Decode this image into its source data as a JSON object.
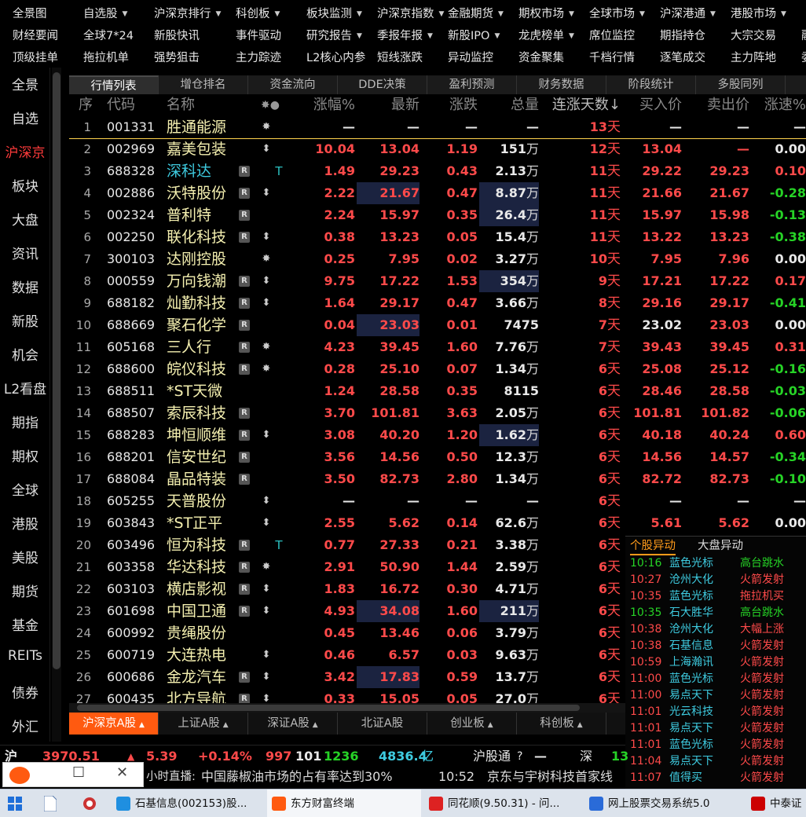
{
  "top_menu": {
    "rows": [
      [
        {
          "label": "全景图",
          "arrow": false
        },
        {
          "label": "自选股",
          "arrow": true
        },
        {
          "label": "沪深京排行",
          "arrow": true
        },
        {
          "label": "科创板",
          "arrow": true
        },
        {
          "label": "板块监测",
          "arrow": true
        },
        {
          "label": "沪深京指数",
          "arrow": true
        },
        {
          "label": "金融期货",
          "arrow": true
        },
        {
          "label": "期权市场",
          "arrow": true
        },
        {
          "label": "全球市场",
          "arrow": true
        },
        {
          "label": "沪深港通",
          "arrow": true
        },
        {
          "label": "港股市场",
          "arrow": true
        }
      ],
      [
        {
          "label": "财经要闻",
          "arrow": false
        },
        {
          "label": "全球7*24",
          "arrow": false
        },
        {
          "label": "新股快讯",
          "arrow": false
        },
        {
          "label": "事件驱动",
          "arrow": false
        },
        {
          "label": "研究报告",
          "arrow": true
        },
        {
          "label": "季报年报",
          "arrow": true
        },
        {
          "label": "新股IPO",
          "arrow": true
        },
        {
          "label": "龙虎榜单",
          "arrow": true
        },
        {
          "label": "席位监控",
          "arrow": false
        },
        {
          "label": "期指持仓",
          "arrow": false
        },
        {
          "label": "大宗交易",
          "arrow": false
        },
        {
          "label": "融",
          "arrow": false
        }
      ],
      [
        {
          "label": "顶级挂单",
          "arrow": false
        },
        {
          "label": "拖拉机单",
          "arrow": false
        },
        {
          "label": "强势狙击",
          "arrow": false
        },
        {
          "label": "主力踪迹",
          "arrow": false
        },
        {
          "label": "L2核心内参",
          "arrow": false
        },
        {
          "label": "短线涨跌",
          "arrow": false
        },
        {
          "label": "异动监控",
          "arrow": false
        },
        {
          "label": "资金聚集",
          "arrow": false
        },
        {
          "label": "千档行情",
          "arrow": false
        },
        {
          "label": "逐笔成交",
          "arrow": false
        },
        {
          "label": "主力阵地",
          "arrow": false
        },
        {
          "label": "委",
          "arrow": false
        }
      ]
    ]
  },
  "left_nav": [
    "全景",
    "自选",
    "沪深京",
    "板块",
    "大盘",
    "资讯",
    "数据",
    "新股",
    "机会",
    "L2看盘",
    "期指",
    "期权",
    "全球",
    "港股",
    "美股",
    "期货",
    "基金",
    "REITs",
    "债券",
    "外汇"
  ],
  "left_nav_active": "沪深京",
  "tabs": [
    "行情列表",
    "增仓排名",
    "资金流向",
    "DDE决策",
    "盈利预测",
    "财务数据",
    "阶段统计",
    "多股同列"
  ],
  "active_tab": "行情列表",
  "columns": {
    "seq": "序",
    "code": "代码",
    "name": "名称",
    "flags": "✸●",
    "chg_pct": "涨幅%",
    "last": "最新",
    "chg": "涨跌",
    "volume": "总量",
    "streak": "连涨天数↓",
    "bid": "买入价",
    "ask": "卖出价",
    "speed": "涨速%"
  },
  "rows": [
    {
      "seq": "1",
      "code": "001331",
      "name": "胜通能源",
      "r": false,
      "mark": "✸",
      "chg_pct": "—",
      "last": "—",
      "chg": "—",
      "vol_num": "—",
      "vol_unit": "",
      "days": "13",
      "bid": "—",
      "ask": "—",
      "speed": "—",
      "color": "white",
      "speed_color": "white",
      "name_color": "yellow",
      "hl_last": false,
      "hl_vol": false
    },
    {
      "seq": "2",
      "code": "002969",
      "name": "嘉美包装",
      "r": false,
      "mark": "⬍",
      "chg_pct": "10.04",
      "last": "13.04",
      "chg": "1.19",
      "vol_num": "151",
      "vol_unit": "万",
      "days": "12",
      "bid": "13.04",
      "ask": "—",
      "speed": "0.00",
      "color": "red",
      "speed_color": "white",
      "name_color": "yellow",
      "hl_last": false,
      "hl_vol": false
    },
    {
      "seq": "3",
      "code": "688328",
      "name": "深科达",
      "r": true,
      "mark": "T",
      "chg_pct": "1.49",
      "last": "29.23",
      "chg": "0.43",
      "vol_num": "2.13",
      "vol_unit": "万",
      "days": "11",
      "bid": "29.22",
      "ask": "29.23",
      "speed": "0.10",
      "color": "red",
      "speed_color": "red",
      "name_color": "cyan",
      "hl_last": false,
      "hl_vol": false
    },
    {
      "seq": "4",
      "code": "002886",
      "name": "沃特股份",
      "r": true,
      "mark": "⬍",
      "chg_pct": "2.22",
      "last": "21.67",
      "chg": "0.47",
      "vol_num": "8.87",
      "vol_unit": "万",
      "days": "11",
      "bid": "21.66",
      "ask": "21.67",
      "speed": "-0.28",
      "color": "red",
      "speed_color": "green",
      "name_color": "yellow",
      "hl_last": true,
      "hl_vol": true
    },
    {
      "seq": "5",
      "code": "002324",
      "name": "普利特",
      "r": true,
      "mark": "",
      "chg_pct": "2.24",
      "last": "15.97",
      "chg": "0.35",
      "vol_num": "26.4",
      "vol_unit": "万",
      "days": "11",
      "bid": "15.97",
      "ask": "15.98",
      "speed": "-0.13",
      "color": "red",
      "speed_color": "green",
      "name_color": "yellow",
      "hl_last": false,
      "hl_vol": true
    },
    {
      "seq": "6",
      "code": "002250",
      "name": "联化科技",
      "r": true,
      "mark": "⬍",
      "chg_pct": "0.38",
      "last": "13.23",
      "chg": "0.05",
      "vol_num": "15.4",
      "vol_unit": "万",
      "days": "11",
      "bid": "13.22",
      "ask": "13.23",
      "speed": "-0.38",
      "color": "red",
      "speed_color": "green",
      "name_color": "yellow",
      "hl_last": false,
      "hl_vol": false
    },
    {
      "seq": "7",
      "code": "300103",
      "name": "达刚控股",
      "r": false,
      "mark": "✸",
      "chg_pct": "0.25",
      "last": "7.95",
      "chg": "0.02",
      "vol_num": "3.27",
      "vol_unit": "万",
      "days": "10",
      "bid": "7.95",
      "ask": "7.96",
      "speed": "0.00",
      "color": "red",
      "speed_color": "white",
      "name_color": "yellow",
      "hl_last": false,
      "hl_vol": false
    },
    {
      "seq": "8",
      "code": "000559",
      "name": "万向钱潮",
      "r": true,
      "mark": "⬍",
      "chg_pct": "9.75",
      "last": "17.22",
      "chg": "1.53",
      "vol_num": "354",
      "vol_unit": "万",
      "days": "9",
      "bid": "17.21",
      "ask": "17.22",
      "speed": "0.17",
      "color": "red",
      "speed_color": "red",
      "name_color": "yellow",
      "hl_last": false,
      "hl_vol": true
    },
    {
      "seq": "9",
      "code": "688182",
      "name": "灿勤科技",
      "r": true,
      "mark": "⬍",
      "chg_pct": "1.64",
      "last": "29.17",
      "chg": "0.47",
      "vol_num": "3.66",
      "vol_unit": "万",
      "days": "8",
      "bid": "29.16",
      "ask": "29.17",
      "speed": "-0.41",
      "color": "red",
      "speed_color": "green",
      "name_color": "yellow",
      "hl_last": false,
      "hl_vol": false
    },
    {
      "seq": "10",
      "code": "688669",
      "name": "聚石化学",
      "r": true,
      "mark": "",
      "chg_pct": "0.04",
      "last": "23.03",
      "chg": "0.01",
      "vol_num": "7475",
      "vol_unit": "",
      "days": "7",
      "bid": "23.02",
      "ask": "23.03",
      "speed": "0.00",
      "color": "red",
      "speed_color": "white",
      "name_color": "yellow",
      "hl_last": true,
      "hl_vol": false,
      "bid_color": "white"
    },
    {
      "seq": "11",
      "code": "605168",
      "name": "三人行",
      "r": true,
      "mark": "✸",
      "chg_pct": "4.23",
      "last": "39.45",
      "chg": "1.60",
      "vol_num": "7.76",
      "vol_unit": "万",
      "days": "7",
      "bid": "39.43",
      "ask": "39.45",
      "speed": "0.31",
      "color": "red",
      "speed_color": "red",
      "name_color": "yellow",
      "hl_last": false,
      "hl_vol": false
    },
    {
      "seq": "12",
      "code": "688600",
      "name": "皖仪科技",
      "r": true,
      "mark": "✸",
      "chg_pct": "0.28",
      "last": "25.10",
      "chg": "0.07",
      "vol_num": "1.34",
      "vol_unit": "万",
      "days": "6",
      "bid": "25.08",
      "ask": "25.12",
      "speed": "-0.16",
      "color": "red",
      "speed_color": "green",
      "name_color": "yellow",
      "hl_last": false,
      "hl_vol": false
    },
    {
      "seq": "13",
      "code": "688511",
      "name": "*ST天微",
      "r": false,
      "mark": "",
      "chg_pct": "1.24",
      "last": "28.58",
      "chg": "0.35",
      "vol_num": "8115",
      "vol_unit": "",
      "days": "6",
      "bid": "28.46",
      "ask": "28.58",
      "speed": "-0.03",
      "color": "red",
      "speed_color": "green",
      "name_color": "yellow",
      "hl_last": false,
      "hl_vol": false
    },
    {
      "seq": "14",
      "code": "688507",
      "name": "索辰科技",
      "r": true,
      "mark": "",
      "chg_pct": "3.70",
      "last": "101.81",
      "chg": "3.63",
      "vol_num": "2.05",
      "vol_unit": "万",
      "days": "6",
      "bid": "101.81",
      "ask": "101.82",
      "speed": "-0.06",
      "color": "red",
      "speed_color": "green",
      "name_color": "yellow",
      "hl_last": false,
      "hl_vol": false
    },
    {
      "seq": "15",
      "code": "688283",
      "name": "坤恒顺维",
      "r": true,
      "mark": "⬍",
      "chg_pct": "3.08",
      "last": "40.20",
      "chg": "1.20",
      "vol_num": "1.62",
      "vol_unit": "万",
      "days": "6",
      "bid": "40.18",
      "ask": "40.24",
      "speed": "0.60",
      "color": "red",
      "speed_color": "red",
      "name_color": "yellow",
      "hl_last": false,
      "hl_vol": true
    },
    {
      "seq": "16",
      "code": "688201",
      "name": "信安世纪",
      "r": true,
      "mark": "",
      "chg_pct": "3.56",
      "last": "14.56",
      "chg": "0.50",
      "vol_num": "12.3",
      "vol_unit": "万",
      "days": "6",
      "bid": "14.56",
      "ask": "14.57",
      "speed": "-0.34",
      "color": "red",
      "speed_color": "green",
      "name_color": "yellow",
      "hl_last": false,
      "hl_vol": false
    },
    {
      "seq": "17",
      "code": "688084",
      "name": "晶品特装",
      "r": true,
      "mark": "",
      "chg_pct": "3.50",
      "last": "82.73",
      "chg": "2.80",
      "vol_num": "1.34",
      "vol_unit": "万",
      "days": "6",
      "bid": "82.72",
      "ask": "82.73",
      "speed": "-0.10",
      "color": "red",
      "speed_color": "green",
      "name_color": "yellow",
      "hl_last": false,
      "hl_vol": false
    },
    {
      "seq": "18",
      "code": "605255",
      "name": "天普股份",
      "r": false,
      "mark": "⬍",
      "chg_pct": "—",
      "last": "—",
      "chg": "—",
      "vol_num": "—",
      "vol_unit": "",
      "days": "6",
      "bid": "—",
      "ask": "—",
      "speed": "—",
      "color": "white",
      "speed_color": "white",
      "name_color": "yellow",
      "hl_last": false,
      "hl_vol": false
    },
    {
      "seq": "19",
      "code": "603843",
      "name": "*ST正平",
      "r": false,
      "mark": "⬍",
      "chg_pct": "2.55",
      "last": "5.62",
      "chg": "0.14",
      "vol_num": "62.6",
      "vol_unit": "万",
      "days": "6",
      "bid": "5.61",
      "ask": "5.62",
      "speed": "0.00",
      "color": "red",
      "speed_color": "white",
      "name_color": "yellow",
      "hl_last": false,
      "hl_vol": false
    },
    {
      "seq": "20",
      "code": "603496",
      "name": "恒为科技",
      "r": true,
      "mark": "T",
      "chg_pct": "0.77",
      "last": "27.33",
      "chg": "0.21",
      "vol_num": "3.38",
      "vol_unit": "万",
      "days": "6",
      "bid": "",
      "ask": "",
      "speed": "",
      "color": "red",
      "speed_color": "white",
      "name_color": "yellow",
      "hl_last": false,
      "hl_vol": false
    },
    {
      "seq": "21",
      "code": "603358",
      "name": "华达科技",
      "r": true,
      "mark": "✸",
      "chg_pct": "2.91",
      "last": "50.90",
      "chg": "1.44",
      "vol_num": "2.59",
      "vol_unit": "万",
      "days": "6",
      "bid": "",
      "ask": "",
      "speed": "",
      "color": "red",
      "speed_color": "white",
      "name_color": "yellow",
      "hl_last": false,
      "hl_vol": false
    },
    {
      "seq": "22",
      "code": "603103",
      "name": "横店影视",
      "r": true,
      "mark": "⬍",
      "chg_pct": "1.83",
      "last": "16.72",
      "chg": "0.30",
      "vol_num": "4.71",
      "vol_unit": "万",
      "days": "6",
      "bid": "",
      "ask": "",
      "speed": "",
      "color": "red",
      "speed_color": "white",
      "name_color": "yellow",
      "hl_last": false,
      "hl_vol": false
    },
    {
      "seq": "23",
      "code": "601698",
      "name": "中国卫通",
      "r": true,
      "mark": "⬍",
      "chg_pct": "4.93",
      "last": "34.08",
      "chg": "1.60",
      "vol_num": "211",
      "vol_unit": "万",
      "days": "6",
      "bid": "",
      "ask": "",
      "speed": "",
      "color": "red",
      "speed_color": "white",
      "name_color": "yellow",
      "hl_last": true,
      "hl_vol": true
    },
    {
      "seq": "24",
      "code": "600992",
      "name": "贵绳股份",
      "r": false,
      "mark": "",
      "chg_pct": "0.45",
      "last": "13.46",
      "chg": "0.06",
      "vol_num": "3.79",
      "vol_unit": "万",
      "days": "6",
      "bid": "",
      "ask": "",
      "speed": "",
      "color": "red",
      "speed_color": "white",
      "name_color": "yellow",
      "hl_last": false,
      "hl_vol": false
    },
    {
      "seq": "25",
      "code": "600719",
      "name": "大连热电",
      "r": false,
      "mark": "⬍",
      "chg_pct": "0.46",
      "last": "6.57",
      "chg": "0.03",
      "vol_num": "9.63",
      "vol_unit": "万",
      "days": "6",
      "bid": "",
      "ask": "",
      "speed": "",
      "color": "red",
      "speed_color": "white",
      "name_color": "yellow",
      "hl_last": false,
      "hl_vol": false
    },
    {
      "seq": "26",
      "code": "600686",
      "name": "金龙汽车",
      "r": true,
      "mark": "⬍",
      "chg_pct": "3.42",
      "last": "17.83",
      "chg": "0.59",
      "vol_num": "13.7",
      "vol_unit": "万",
      "days": "6",
      "bid": "",
      "ask": "",
      "speed": "",
      "color": "red",
      "speed_color": "white",
      "name_color": "yellow",
      "hl_last": true,
      "hl_vol": false
    },
    {
      "seq": "27",
      "code": "600435",
      "name": "北方导航",
      "r": true,
      "mark": "⬍",
      "chg_pct": "0.33",
      "last": "15.05",
      "chg": "0.05",
      "vol_num": "27.0",
      "vol_unit": "万",
      "days": "6",
      "bid": "",
      "ask": "",
      "speed": "",
      "color": "red",
      "speed_color": "white",
      "name_color": "yellow",
      "hl_last": false,
      "hl_vol": false
    }
  ],
  "days_unit": "天",
  "r_badge": "R",
  "bottom_tabs": [
    {
      "label": "沪深京A股",
      "arrow": true
    },
    {
      "label": "上证A股",
      "arrow": true
    },
    {
      "label": "深证A股",
      "arrow": true
    },
    {
      "label": "北证A股",
      "arrow": false
    },
    {
      "label": "创业板",
      "arrow": true
    },
    {
      "label": "科创板",
      "arrow": true
    }
  ],
  "movers": {
    "tabs": [
      "个股异动",
      "大盘异动"
    ],
    "items": [
      {
        "time": "10:16",
        "name": "蓝色光标",
        "event": "高台跳水",
        "up": false
      },
      {
        "time": "10:27",
        "name": "沧州大化",
        "event": "火箭发射",
        "up": true
      },
      {
        "time": "10:35",
        "name": "蓝色光标",
        "event": "拖拉机买",
        "up": true
      },
      {
        "time": "10:35",
        "name": "石大胜华",
        "event": "高台跳水",
        "up": false
      },
      {
        "time": "10:38",
        "name": "沧州大化",
        "event": "大幅上涨",
        "up": true
      },
      {
        "time": "10:38",
        "name": "石基信息",
        "event": "火箭发射",
        "up": true
      },
      {
        "time": "10:59",
        "name": "上海瀚讯",
        "event": "火箭发射",
        "up": true
      },
      {
        "time": "11:00",
        "name": "蓝色光标",
        "event": "火箭发射",
        "up": true
      },
      {
        "time": "11:00",
        "name": "易点天下",
        "event": "火箭发射",
        "up": true
      },
      {
        "time": "11:01",
        "name": "光云科技",
        "event": "火箭发射",
        "up": true
      },
      {
        "time": "11:01",
        "name": "易点天下",
        "event": "火箭发射",
        "up": true
      },
      {
        "time": "11:01",
        "name": "蓝色光标",
        "event": "火箭发射",
        "up": true
      },
      {
        "time": "11:04",
        "name": "易点天下",
        "event": "火箭发射",
        "up": true
      },
      {
        "time": "11:07",
        "name": "值得买",
        "event": "火箭发射",
        "up": true
      }
    ]
  },
  "status_bar": {
    "market": "沪",
    "index": "3970.51",
    "change": "5.39",
    "change_pct": "+0.14%",
    "up_count": "997",
    "flat_count": "101",
    "down_count": "1236",
    "turnover": "4836.4",
    "turnover_unit": "亿",
    "connect_label": "沪股通",
    "connect_value": "—",
    "market2": "深",
    "market2_value": "13"
  },
  "news_bar": {
    "prefix": "小时直播:",
    "headline": "中国藤椒油市场的占有率达到30%",
    "time": "10:52",
    "headline2": "京东与宇树科技首家线"
  },
  "taskbar": [
    {
      "label": "石基信息(002153)股...",
      "icon": "edge-icon",
      "active": false
    },
    {
      "label": "东方财富终端",
      "icon": "eastmoney-icon",
      "active": true
    },
    {
      "label": "同花顺(9.50.31) - 问...",
      "icon": "ths-icon",
      "active": false
    },
    {
      "label": "网上股票交易系统5.0",
      "icon": "trade-icon",
      "active": false
    },
    {
      "label": "中泰证",
      "icon": "zt-icon",
      "active": false
    }
  ],
  "colors": {
    "up": "#ff4a4a",
    "down": "#26d326",
    "name": "#f5f0b0",
    "accent": "#ff5a10",
    "movers_active": "#ff9a1a",
    "cyan": "#3ecbe0"
  }
}
